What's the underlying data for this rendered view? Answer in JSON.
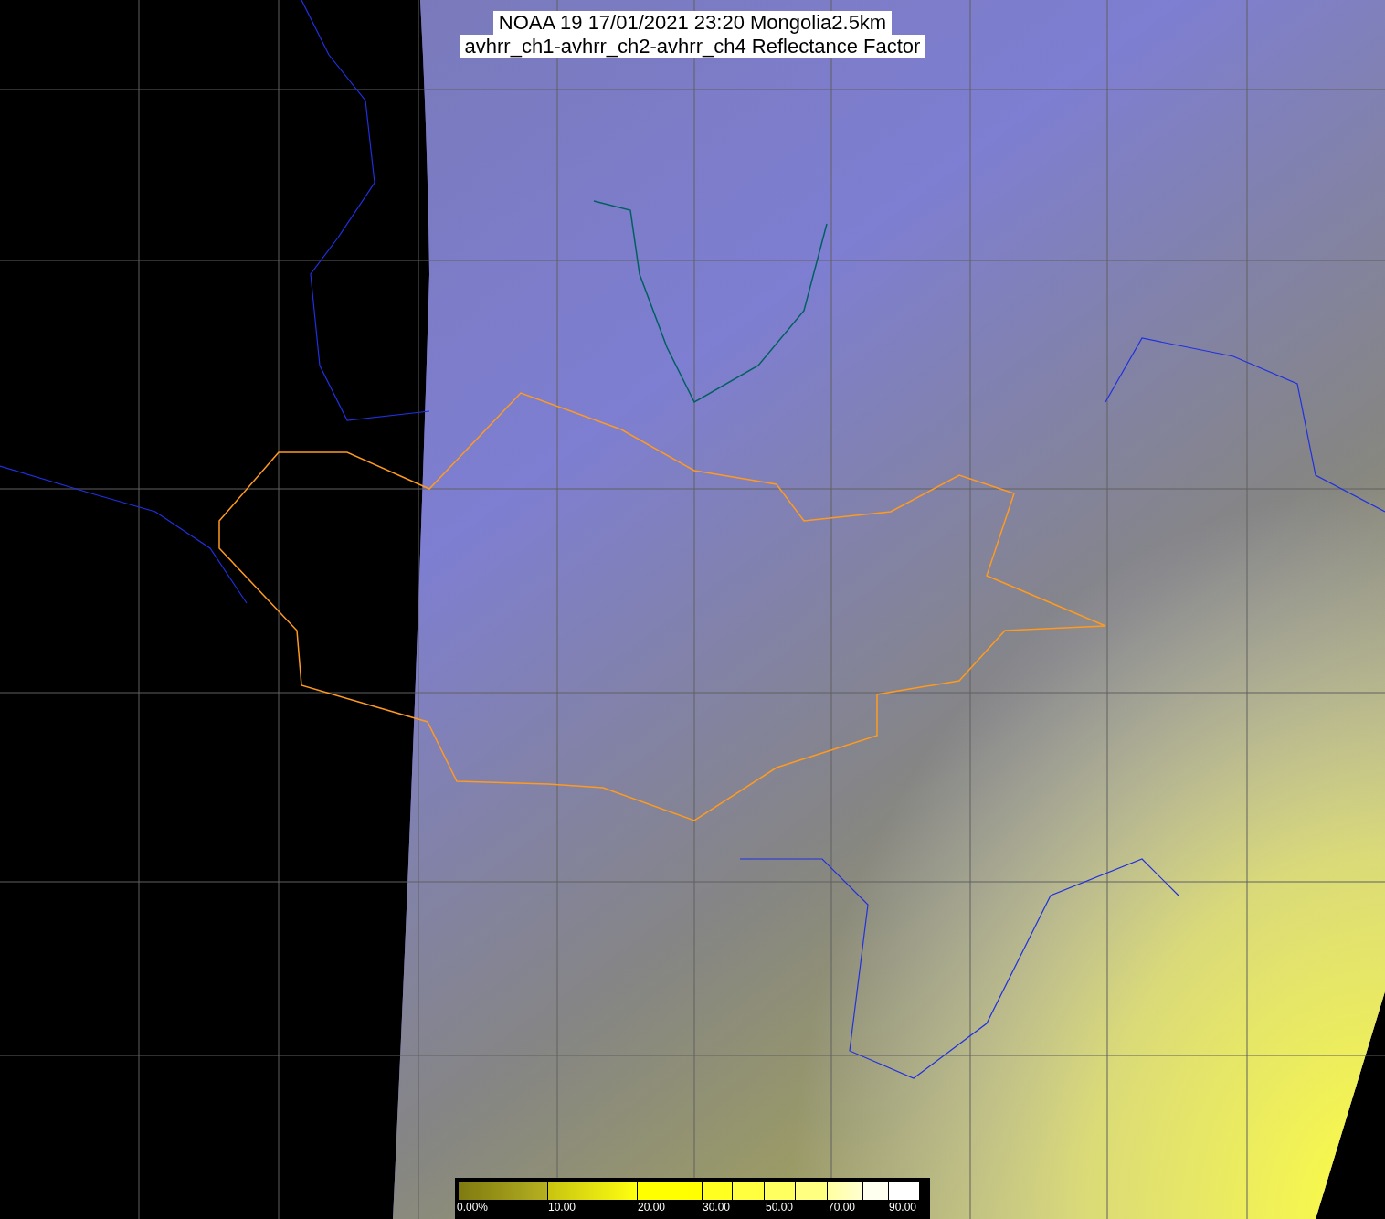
{
  "title": {
    "lines": [
      "NOAA 19 17/01/2021 23:20 Mongolia2.5km",
      "avhrr_ch1-avhrr_ch2-avhrr_ch4 Reflectance Factor"
    ]
  },
  "legend": {
    "labels": [
      "0.00%",
      "10.00",
      "20.00",
      "30.00",
      "50.00",
      "70.00",
      "90.00"
    ]
  }
}
